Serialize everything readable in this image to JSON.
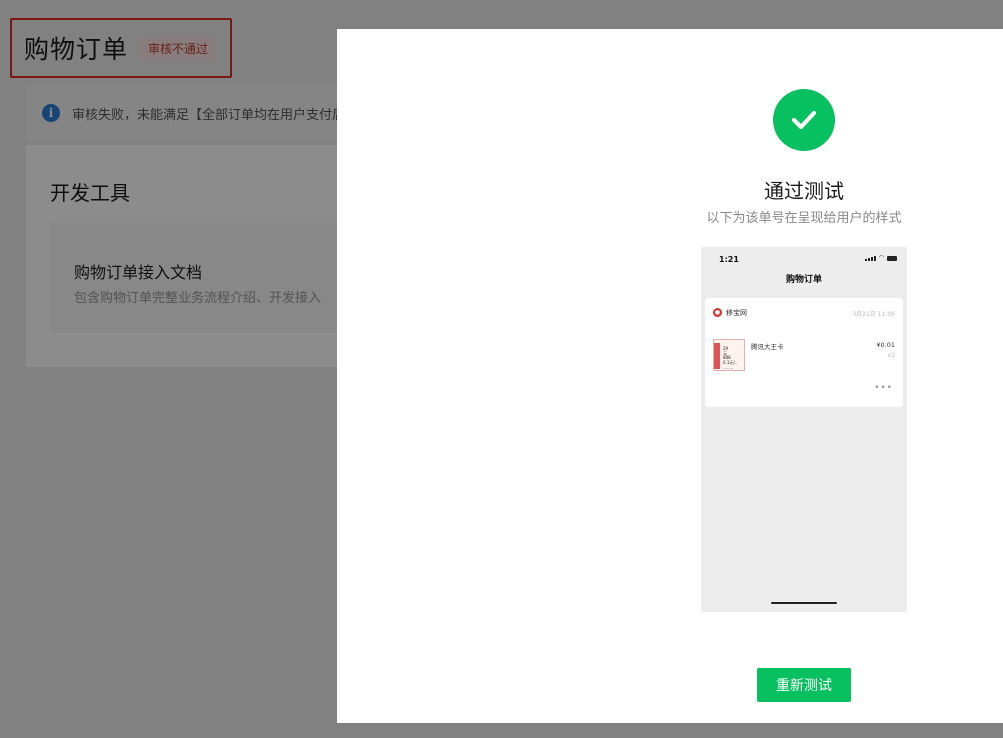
{
  "header": {
    "title": "购物订单",
    "status_badge": "审核不通过"
  },
  "notice": {
    "icon": "info-icon",
    "text": "审核失败，未能满足【全部订单均在用户支付后"
  },
  "dev_tools": {
    "section_title": "开发工具",
    "doc_card": {
      "title": "购物订单接入文档",
      "description": "包含购物订单完整业务流程介绍、开发接入"
    }
  },
  "modal": {
    "success_icon": "check-icon",
    "title": "通过测试",
    "subtitle": "以下为该单号在呈现给用户的样式",
    "retest_label": "重新测试",
    "accent_color": "#07c160"
  },
  "phone_preview": {
    "time": "1:21",
    "screen_title": "购物订单",
    "shop_name": "移宝网",
    "order_date": "3月21日 11:06",
    "product_name": "腾讯大王卡",
    "price": "¥0.01",
    "quantity": "x1",
    "thumb_lines": [
      "29",
      "元",
      "888",
      "0.1元/..",
      "........"
    ]
  }
}
